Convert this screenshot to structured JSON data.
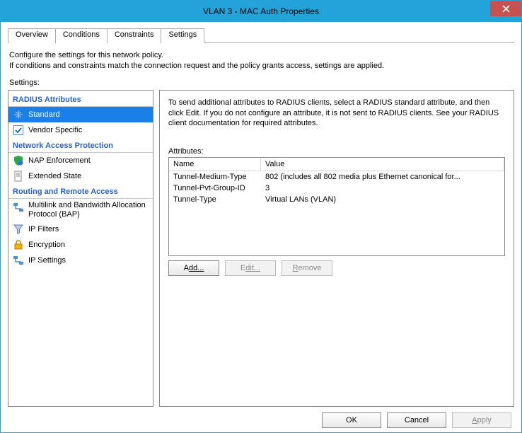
{
  "window": {
    "title": "VLAN 3 - MAC Auth Properties"
  },
  "tabs": {
    "overview": "Overview",
    "conditions": "Conditions",
    "constraints": "Constraints",
    "settings": "Settings"
  },
  "description": {
    "line1": "Configure the settings for this network policy.",
    "line2": "If conditions and constraints match the connection request and the policy grants access, settings are applied."
  },
  "labels": {
    "settings": "Settings:",
    "attributes": "Attributes:"
  },
  "categories": {
    "radius": {
      "header": "RADIUS Attributes",
      "standard": "Standard",
      "vendor": "Vendor Specific"
    },
    "nap": {
      "header": "Network Access Protection",
      "enforcement": "NAP Enforcement",
      "extended": "Extended State"
    },
    "rras": {
      "header": "Routing and Remote Access",
      "multilink": "Multilink and Bandwidth Allocation Protocol (BAP)",
      "ipfilters": "IP Filters",
      "encryption": "Encryption",
      "ipsettings": "IP Settings"
    }
  },
  "right": {
    "instructions": "To send additional attributes to RADIUS clients, select a RADIUS standard attribute, and then click Edit. If you do not configure an attribute, it is not sent to RADIUS clients. See your RADIUS client documentation for required attributes."
  },
  "grid": {
    "headers": {
      "name": "Name",
      "value": "Value"
    },
    "rows": [
      {
        "name": "Tunnel-Medium-Type",
        "value": "802 (includes all 802 media plus Ethernet canonical for..."
      },
      {
        "name": "Tunnel-Pvt-Group-ID",
        "value": "3"
      },
      {
        "name": "Tunnel-Type",
        "value": "Virtual LANs (VLAN)"
      }
    ]
  },
  "buttons": {
    "add": "dd...",
    "edit": "dit...",
    "remove": "emove",
    "ok": "OK",
    "cancel": "Cancel",
    "apply": "pply"
  }
}
